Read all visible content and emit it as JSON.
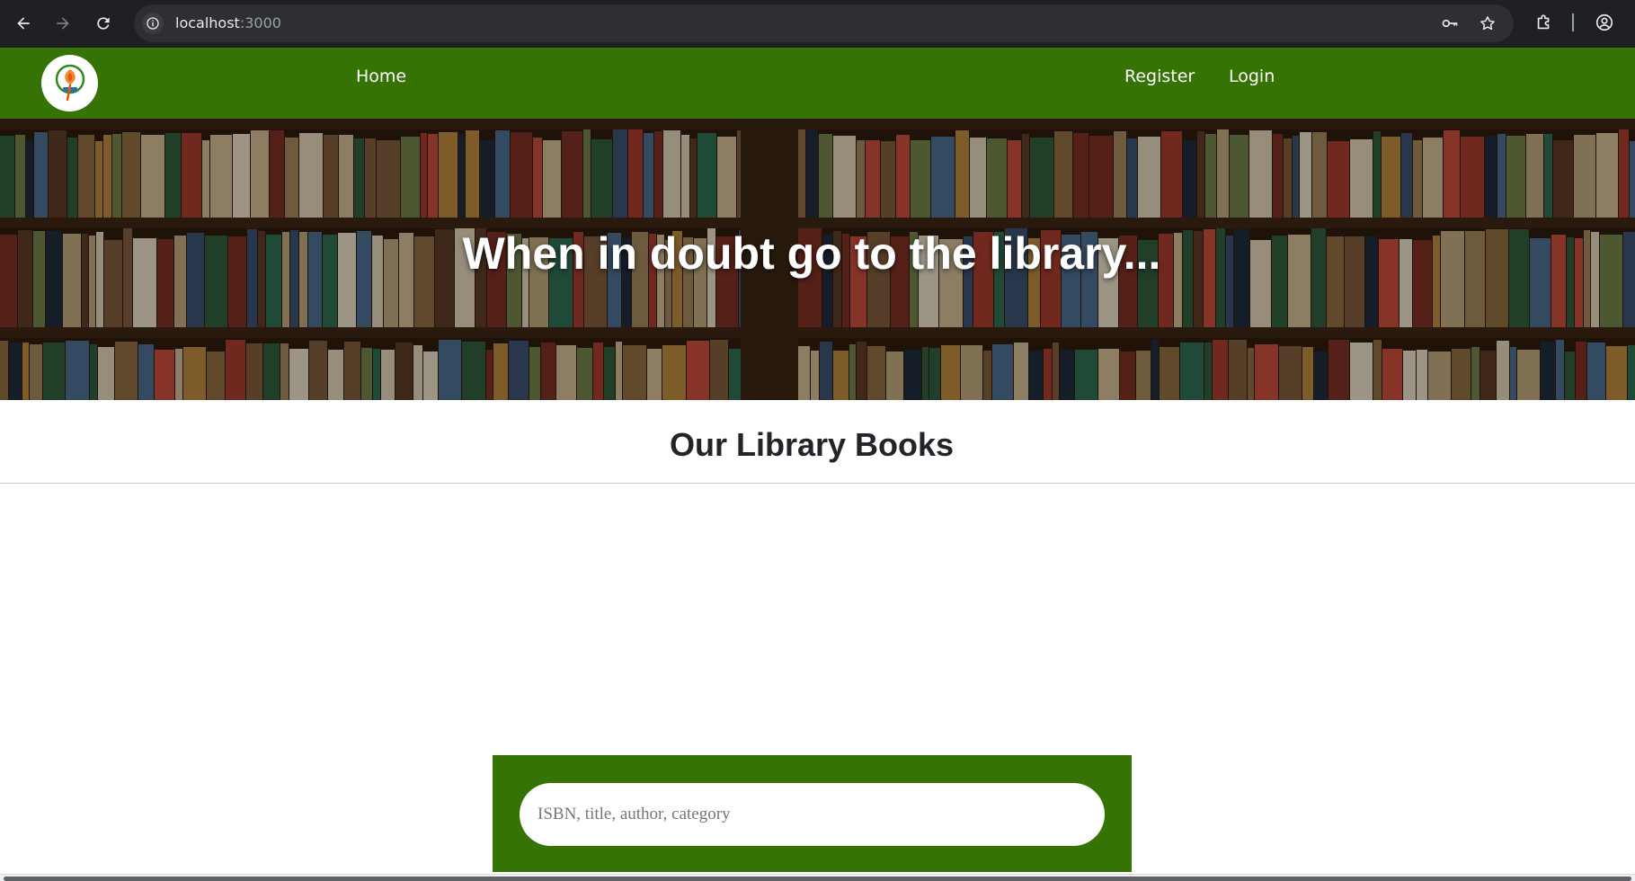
{
  "browser": {
    "url_host": "localhost",
    "url_port": ":3000",
    "icons": [
      "back-icon",
      "forward-icon",
      "reload-icon",
      "site-info-icon",
      "password-key-icon",
      "bookmark-star-icon",
      "extensions-icon",
      "profile-icon"
    ]
  },
  "navbar": {
    "links": {
      "home": "Home",
      "register": "Register",
      "login": "Login"
    },
    "logo_icon": "library-logo-icon",
    "background_color": "#367305"
  },
  "hero": {
    "title": "When in doubt go to the library..."
  },
  "section": {
    "title": "Our Library Books"
  },
  "search": {
    "placeholder": "ISBN, title, author, category",
    "value": "",
    "panel_color": "#367305"
  }
}
